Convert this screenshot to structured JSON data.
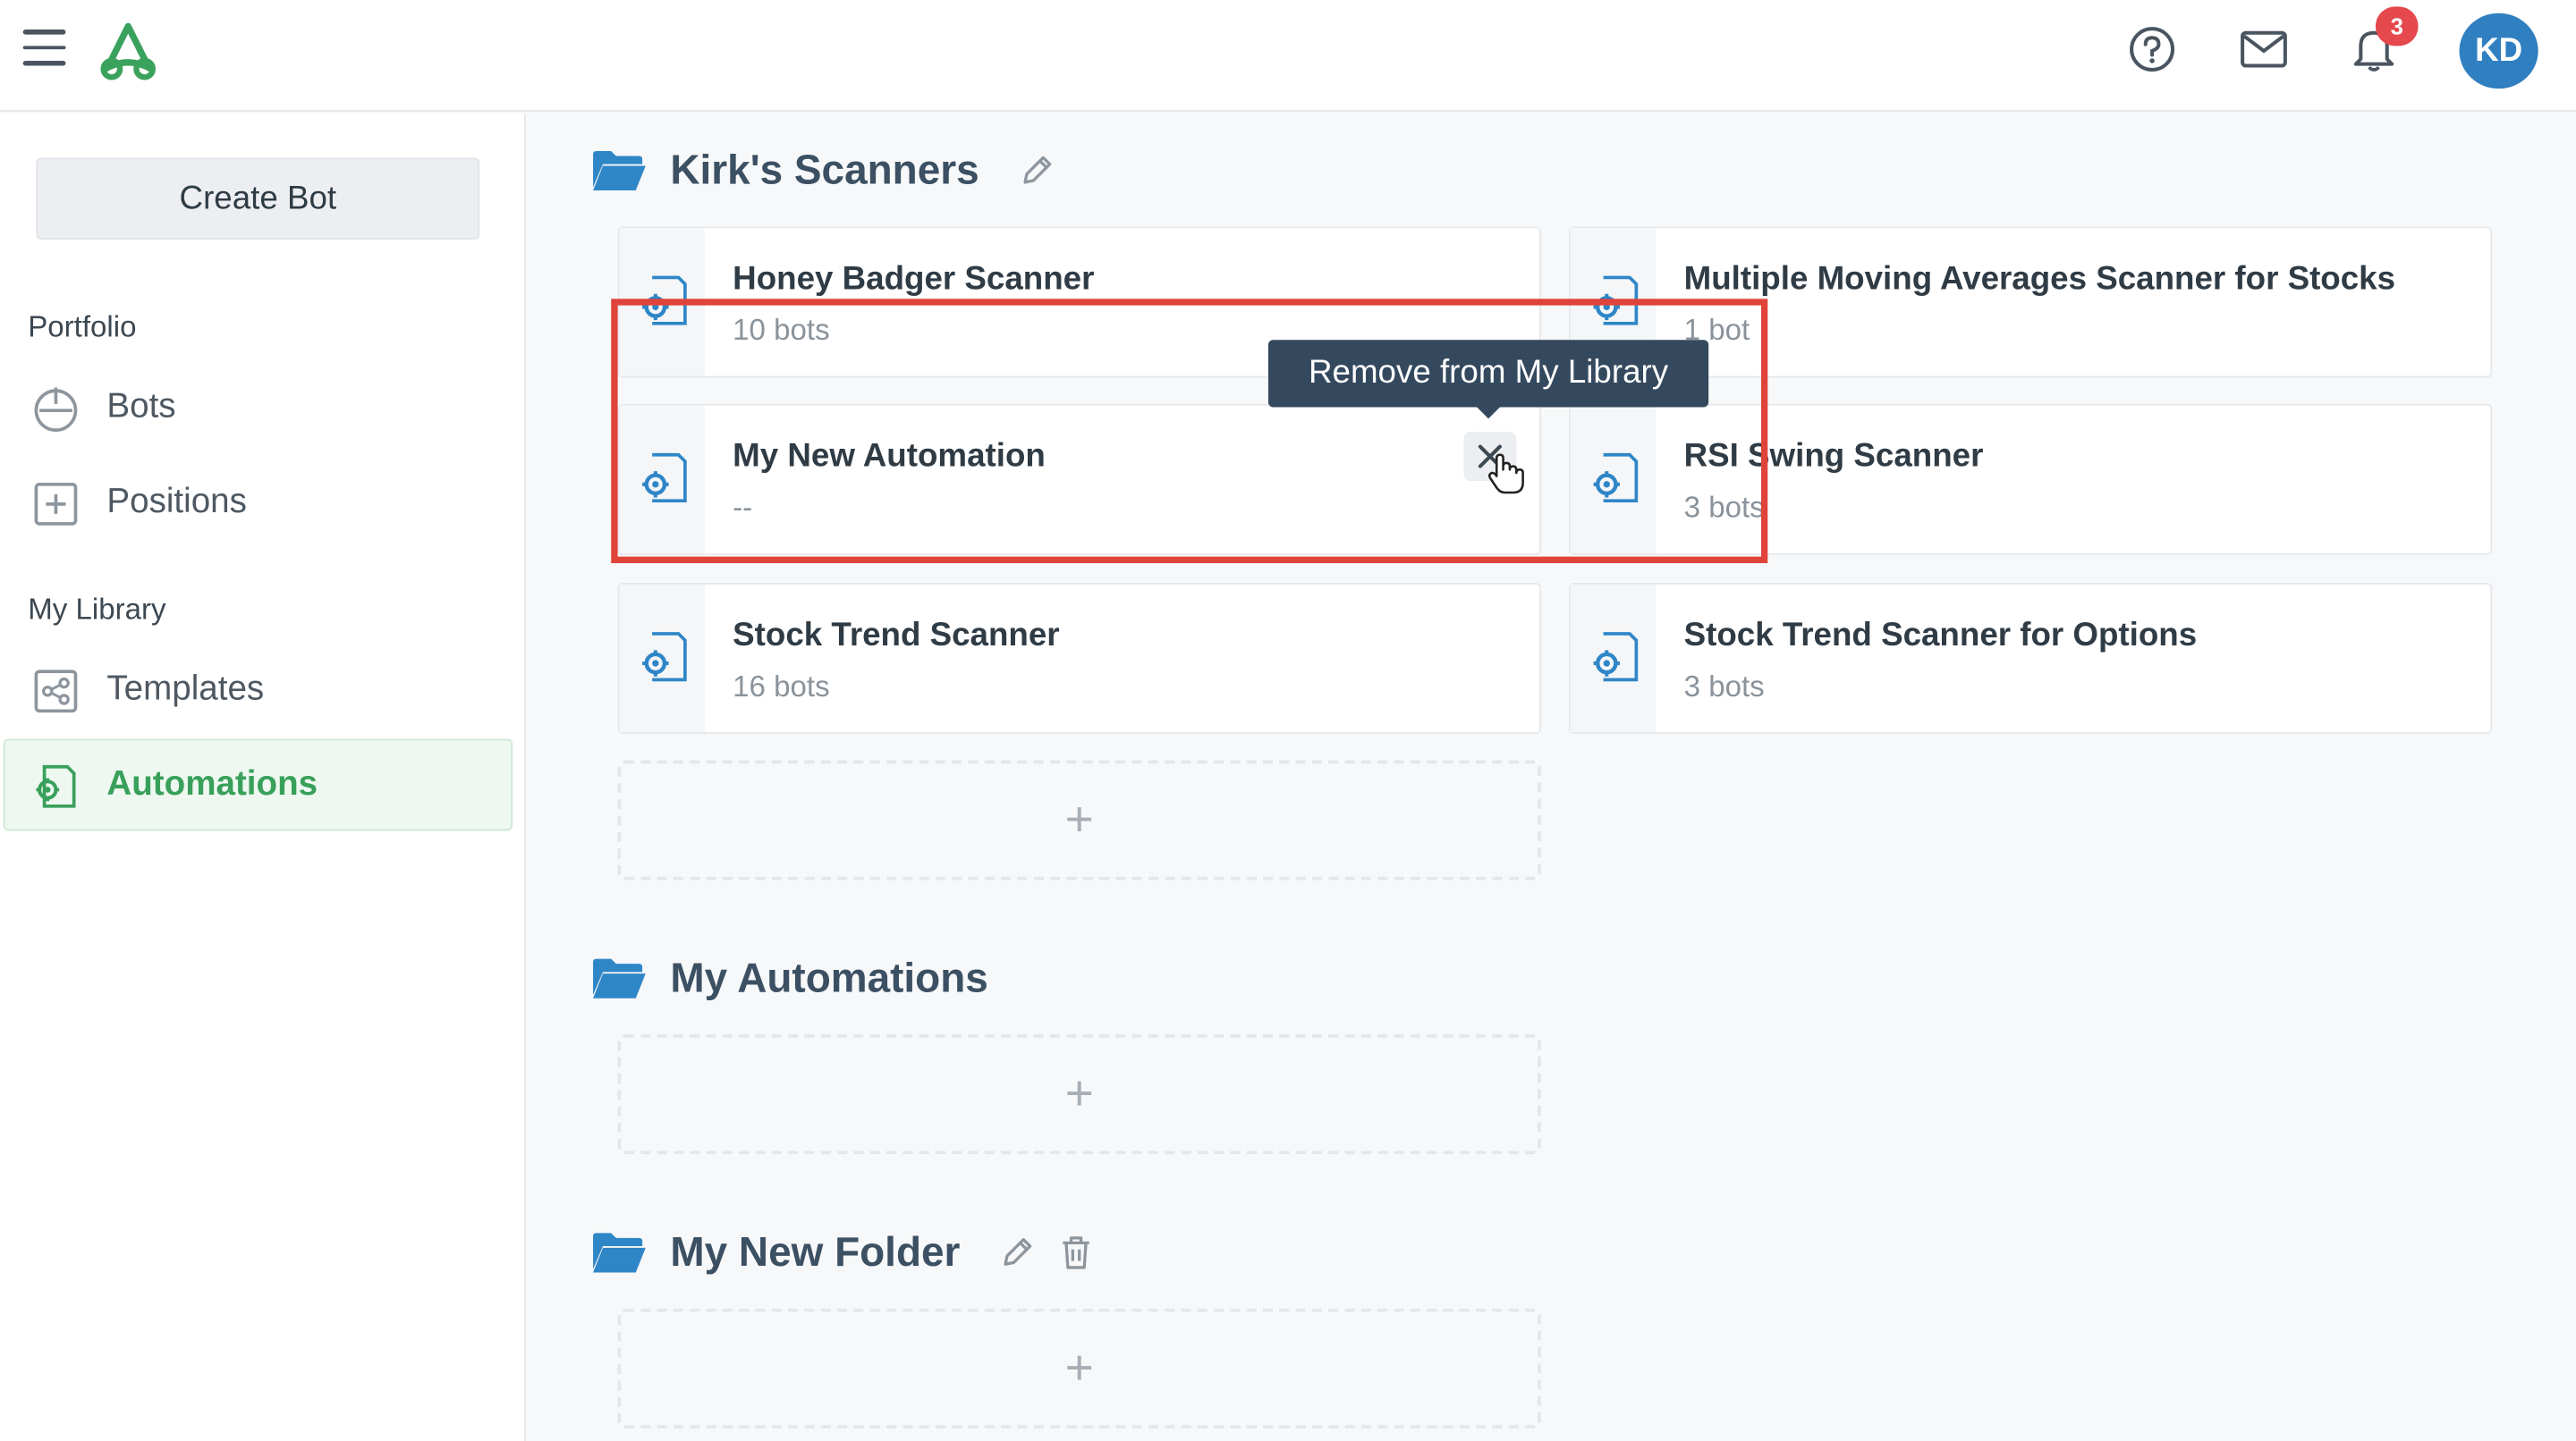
{
  "topbar": {
    "notifications_count": "3",
    "avatar_initials": "KD",
    "icons": [
      "menu-icon",
      "logo-icon",
      "help-icon",
      "mail-icon",
      "bell-icon"
    ]
  },
  "sidebar": {
    "create_bot_label": "Create Bot",
    "portfolio_label": "Portfolio",
    "portfolio_items": [
      {
        "label": "Bots",
        "icon": "power-icon"
      },
      {
        "label": "Positions",
        "icon": "plus-square-icon"
      }
    ],
    "library_label": "My Library",
    "library_items": [
      {
        "label": "Templates",
        "icon": "share-icon"
      },
      {
        "label": "Automations",
        "icon": "gear-doc-icon",
        "active": true
      }
    ]
  },
  "folders": [
    {
      "title": "Kirk's Scanners",
      "cards": [
        {
          "title": "Honey Badger Scanner",
          "subtitle": "10 bots"
        },
        {
          "title": "Multiple Moving Averages Scanner for Stocks",
          "subtitle": "1 bot"
        },
        {
          "title": "My New Automation",
          "subtitle": "--"
        },
        {
          "title": "RSI Swing Scanner",
          "subtitle": "3 bots"
        },
        {
          "title": "Stock Trend Scanner",
          "subtitle": "16 bots"
        },
        {
          "title": "Stock Trend Scanner for Options",
          "subtitle": "3 bots"
        }
      ],
      "add_symbol": "+"
    },
    {
      "title": "My Automations",
      "cards": [],
      "add_symbol": "+"
    },
    {
      "title": "My New Folder",
      "cards": [],
      "add_symbol": "+"
    }
  ],
  "tooltip": {
    "text": "Remove from My Library"
  },
  "colors": {
    "accent_green": "#38a05a",
    "folder_blue": "#2f86c7",
    "badge_red": "#e5484d",
    "highlight_red": "#e0433a",
    "tooltip_bg": "#34495e"
  }
}
